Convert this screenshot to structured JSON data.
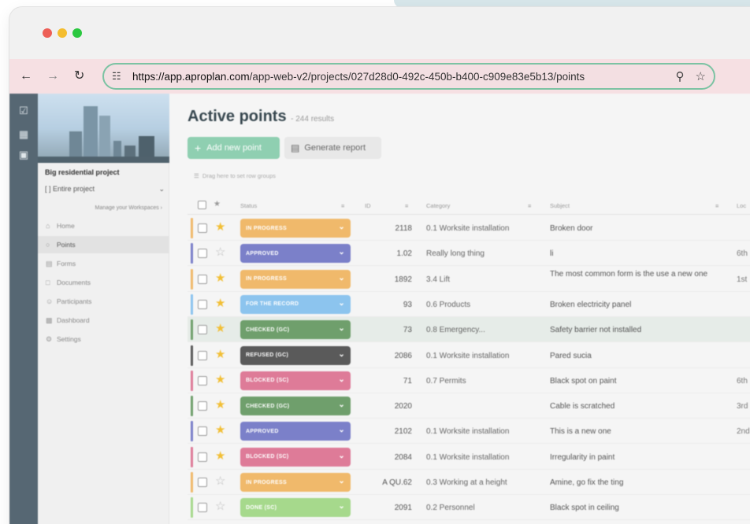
{
  "browser": {
    "url_host": "https://app.aproplan.com",
    "url_path": "/app-web-v2/projects/027d28d0-492c-450b-b400-c909e83e5b13/points",
    "traffic_colors": [
      "#ed5f57",
      "#f4bd2f",
      "#2bc840"
    ]
  },
  "sidebar": {
    "project_name": "Big residential project",
    "scope": "Entire project",
    "manage_link": "Manage your Workspaces",
    "items": [
      {
        "label": "Home",
        "icon": "home-icon"
      },
      {
        "label": "Points",
        "icon": "pin-icon"
      },
      {
        "label": "Forms",
        "icon": "form-icon"
      },
      {
        "label": "Documents",
        "icon": "folder-icon"
      },
      {
        "label": "Participants",
        "icon": "people-icon"
      },
      {
        "label": "Dashboard",
        "icon": "chart-icon"
      },
      {
        "label": "Settings",
        "icon": "gear-icon"
      }
    ]
  },
  "main": {
    "title": "Active points",
    "count": "- 244 results",
    "add_button": "Add new point",
    "report_button": "Generate report",
    "drag_hint": "Drag here to set row groups",
    "columns": {
      "status": "Status",
      "id": "ID",
      "category": "Category",
      "subject": "Subject",
      "location": "Loc"
    },
    "rows": [
      {
        "status": "IN PROGRESS",
        "color": "#f0b96b",
        "starred": true,
        "id": "2118",
        "category": "0.1 Worksite installation",
        "subject": "Broken door",
        "location": ""
      },
      {
        "status": "APPROVED",
        "color": "#7b80c9",
        "starred": false,
        "id": "1.02",
        "category": "Really long thing",
        "subject": "li",
        "location": "6th"
      },
      {
        "status": "IN PROGRESS",
        "color": "#f0b96b",
        "starred": true,
        "id": "1892",
        "category": "3.4 Lift",
        "subject": "The most common form is the use a new one",
        "location": "1st"
      },
      {
        "status": "FOR THE RECORD",
        "color": "#8cc4ee",
        "starred": true,
        "id": "93",
        "category": "0.6 Products",
        "subject": "Broken electricity panel",
        "location": ""
      },
      {
        "status": "CHECKED (GC)",
        "color": "#6f9f6c",
        "starred": true,
        "id": "73",
        "category": "0.8 Emergency...",
        "subject": "Safety barrier not installed",
        "location": "",
        "highlight": true
      },
      {
        "status": "REFUSED (GC)",
        "color": "#5a5a5a",
        "starred": true,
        "id": "2086",
        "category": "0.1 Worksite installation",
        "subject": "Pared sucia",
        "location": ""
      },
      {
        "status": "BLOCKED (SC)",
        "color": "#de7b98",
        "starred": true,
        "id": "71",
        "category": "0.7 Permits",
        "subject": "Black spot on paint",
        "location": "6th"
      },
      {
        "status": "CHECKED (GC)",
        "color": "#6f9f6c",
        "starred": true,
        "id": "2020",
        "category": "",
        "subject": "Cable is scratched",
        "location": "3rd"
      },
      {
        "status": "APPROVED",
        "color": "#7b80c9",
        "starred": true,
        "id": "2102",
        "category": "0.1 Worksite installation",
        "subject": "This is a new one",
        "location": "2nd"
      },
      {
        "status": "BLOCKED (SC)",
        "color": "#de7b98",
        "starred": true,
        "id": "2084",
        "category": "0.1 Worksite installation",
        "subject": "Irregularity in paint",
        "location": ""
      },
      {
        "status": "IN PROGRESS",
        "color": "#f0b96b",
        "starred": false,
        "id": "A QU.62",
        "category": "0.3 Working at a height",
        "subject": "Amine, go fix the ting",
        "location": ""
      },
      {
        "status": "DONE (SC)",
        "color": "#a6d98c",
        "starred": false,
        "id": "2091",
        "category": "0.2 Personnel",
        "subject": "Black spot in ceiling",
        "location": ""
      }
    ]
  }
}
